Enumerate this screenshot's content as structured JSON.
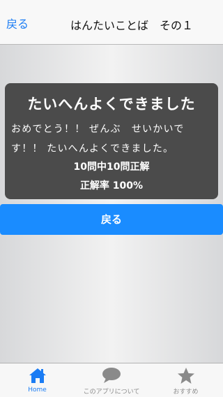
{
  "navbar": {
    "back_label": "戻る",
    "title": "はんたいことば　その１"
  },
  "result": {
    "headline": "たいへんよくできました",
    "message": "おめでとう！！ ぜんぶ　せいかいです！！ たいへんよくできました。",
    "count": "10問中10問正解",
    "rate": "正解率 100%"
  },
  "actions": {
    "back_button_label": "戻る"
  },
  "tabbar": {
    "items": [
      {
        "label": "Home",
        "icon": "home-icon",
        "selected": true
      },
      {
        "label": "このアプリについて",
        "icon": "chat-bubble-icon",
        "selected": false
      },
      {
        "label": "おすすめ",
        "icon": "star-icon",
        "selected": false
      }
    ]
  },
  "colors": {
    "accent": "#1a7cf4",
    "button": "#1a8cff",
    "panel": "#4b4b4b",
    "tab_inactive": "#8a8a8a"
  }
}
